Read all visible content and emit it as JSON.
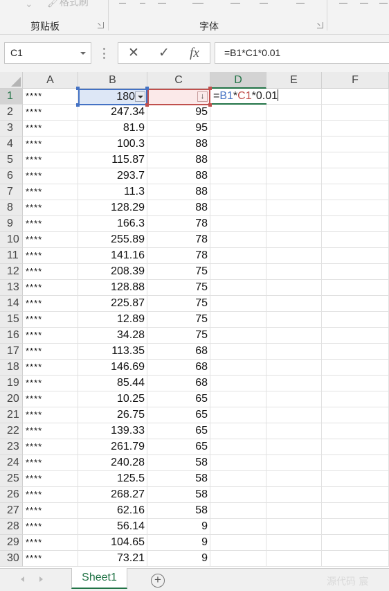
{
  "ribbon": {
    "clipboard_label": "剪贴板",
    "font_label": "字体",
    "format_painter_label": "格式刷"
  },
  "formula_bar": {
    "name_box": "C1",
    "cancel_symbol": "✕",
    "enter_symbol": "✓",
    "function_symbol": "fx",
    "formula": "=B1*C1*0.01"
  },
  "columns": [
    "A",
    "B",
    "C",
    "D",
    "E",
    "F"
  ],
  "rows": [
    {
      "n": "1",
      "a": "****",
      "b": "180",
      "c": "",
      "d": ""
    },
    {
      "n": "2",
      "a": "****",
      "b": "247.34",
      "c": "95"
    },
    {
      "n": "3",
      "a": "****",
      "b": "81.9",
      "c": "95"
    },
    {
      "n": "4",
      "a": "****",
      "b": "100.3",
      "c": "88"
    },
    {
      "n": "5",
      "a": "****",
      "b": "115.87",
      "c": "88"
    },
    {
      "n": "6",
      "a": "****",
      "b": "293.7",
      "c": "88"
    },
    {
      "n": "7",
      "a": "****",
      "b": "11.3",
      "c": "88"
    },
    {
      "n": "8",
      "a": "****",
      "b": "128.29",
      "c": "88"
    },
    {
      "n": "9",
      "a": "****",
      "b": "166.3",
      "c": "78"
    },
    {
      "n": "10",
      "a": "****",
      "b": "255.89",
      "c": "78"
    },
    {
      "n": "11",
      "a": "****",
      "b": "141.16",
      "c": "78"
    },
    {
      "n": "12",
      "a": "****",
      "b": "208.39",
      "c": "75"
    },
    {
      "n": "13",
      "a": "****",
      "b": "128.88",
      "c": "75"
    },
    {
      "n": "14",
      "a": "****",
      "b": "225.87",
      "c": "75"
    },
    {
      "n": "15",
      "a": "****",
      "b": "12.89",
      "c": "75"
    },
    {
      "n": "16",
      "a": "****",
      "b": "34.28",
      "c": "75"
    },
    {
      "n": "17",
      "a": "****",
      "b": "113.35",
      "c": "68"
    },
    {
      "n": "18",
      "a": "****",
      "b": "146.69",
      "c": "68"
    },
    {
      "n": "19",
      "a": "****",
      "b": "85.44",
      "c": "68"
    },
    {
      "n": "20",
      "a": "****",
      "b": "10.25",
      "c": "65"
    },
    {
      "n": "21",
      "a": "****",
      "b": "26.75",
      "c": "65"
    },
    {
      "n": "22",
      "a": "****",
      "b": "139.33",
      "c": "65"
    },
    {
      "n": "23",
      "a": "****",
      "b": "261.79",
      "c": "65"
    },
    {
      "n": "24",
      "a": "****",
      "b": "240.28",
      "c": "58"
    },
    {
      "n": "25",
      "a": "****",
      "b": "125.5",
      "c": "58"
    },
    {
      "n": "26",
      "a": "****",
      "b": "268.27",
      "c": "58"
    },
    {
      "n": "27",
      "a": "****",
      "b": "62.16",
      "c": "58"
    },
    {
      "n": "28",
      "a": "****",
      "b": "56.14",
      "c": "9"
    },
    {
      "n": "29",
      "a": "****",
      "b": "104.65",
      "c": "9"
    },
    {
      "n": "30",
      "a": "****",
      "b": "73.21",
      "c": "9"
    }
  ],
  "editing_cell": {
    "eq": "=",
    "ref1": "B1",
    "op1": "*",
    "ref2": "C1",
    "op2": "*",
    "tail": "0.01"
  },
  "sheet_tabs": [
    "Sheet1"
  ],
  "add_sheet_symbol": "+",
  "watermark": "源代码  宸",
  "colors": {
    "accent": "#217346",
    "ref_b": "#4472c4",
    "ref_c": "#c0504d"
  }
}
